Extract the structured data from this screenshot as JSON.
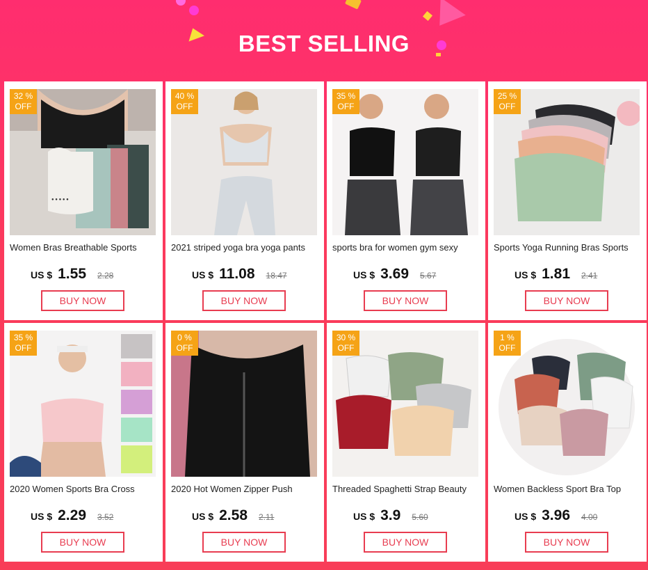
{
  "header": {
    "title": "BEST SELLING"
  },
  "colors": {
    "accent": "#e83c50",
    "badge": "#f5a316",
    "background": "#fb3a5c"
  },
  "products": [
    {
      "discount": "32 %",
      "off": "OFF",
      "name": "Women Bras Breathable Sports",
      "currency": "US $",
      "price": "1.55",
      "old_price": "2.28",
      "buy": "BUY NOW"
    },
    {
      "discount": "40 %",
      "off": "OFF",
      "name": "2021 striped yoga bra yoga pants",
      "currency": "US $",
      "price": "11.08",
      "old_price": "18.47",
      "buy": "BUY NOW"
    },
    {
      "discount": "35 %",
      "off": "OFF",
      "name": "sports bra for women gym sexy",
      "currency": "US $",
      "price": "3.69",
      "old_price": "5.67",
      "buy": "BUY NOW"
    },
    {
      "discount": "25 %",
      "off": "OFF",
      "name": "Sports Yoga Running Bras Sports",
      "currency": "US $",
      "price": "1.81",
      "old_price": "2.41",
      "buy": "BUY NOW"
    },
    {
      "discount": "35 %",
      "off": "OFF",
      "name": "2020 Women Sports Bra Cross",
      "currency": "US $",
      "price": "2.29",
      "old_price": "3.52",
      "buy": "BUY NOW"
    },
    {
      "discount": "0 %",
      "off": "OFF",
      "name": "2020 Hot Women Zipper Push",
      "currency": "US $",
      "price": "2.58",
      "old_price": "2.11",
      "buy": "BUY NOW"
    },
    {
      "discount": "30 %",
      "off": "OFF",
      "name": "Threaded Spaghetti Strap Beauty",
      "currency": "US $",
      "price": "3.9",
      "old_price": "5.60",
      "buy": "BUY NOW"
    },
    {
      "discount": "1 %",
      "off": "OFF",
      "name": "Women Backless Sport  Bra Top",
      "currency": "US $",
      "price": "3.96",
      "old_price": "4.00",
      "buy": "BUY NOW"
    }
  ]
}
